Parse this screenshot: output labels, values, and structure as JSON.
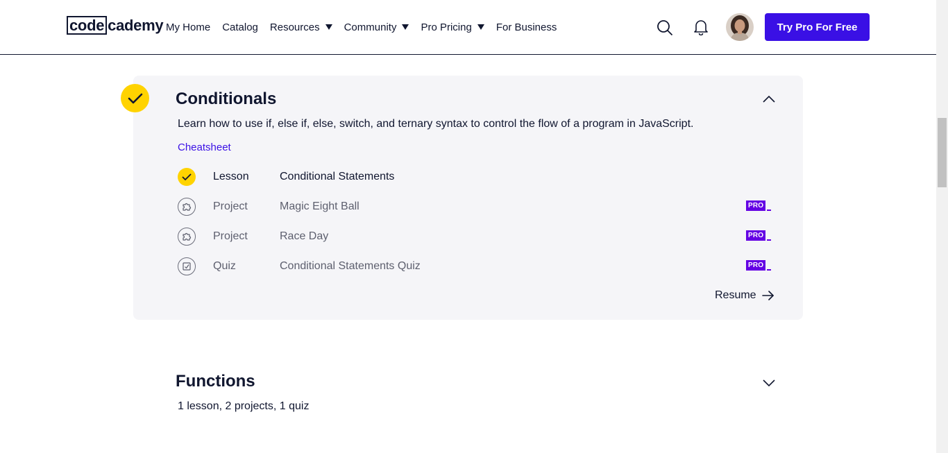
{
  "header": {
    "logo_boxed": "code",
    "logo_rest": "cademy",
    "nav": [
      {
        "label": "My Home",
        "has_caret": false
      },
      {
        "label": "Catalog",
        "has_caret": false
      },
      {
        "label": "Resources",
        "has_caret": true
      },
      {
        "label": "Community",
        "has_caret": true
      },
      {
        "label": "Pro Pricing",
        "has_caret": true
      },
      {
        "label": "For Business",
        "has_caret": false
      }
    ],
    "cta_label": "Try Pro For Free",
    "icons": {
      "search": "search-icon",
      "bell": "bell-icon",
      "caret": "caret-down-icon"
    }
  },
  "modules": [
    {
      "title": "Conditionals",
      "completed": true,
      "expanded": true,
      "description": "Learn how to use if, else if, else, switch, and ternary syntax to control the flow of a program in JavaScript.",
      "cheatsheet_label": "Cheatsheet",
      "items": [
        {
          "type": "Lesson",
          "name": "Conditional Statements",
          "completed": true,
          "pro": false,
          "icon": "check-icon"
        },
        {
          "type": "Project",
          "name": "Magic Eight Ball",
          "completed": false,
          "pro": true,
          "icon": "puzzle-icon"
        },
        {
          "type": "Project",
          "name": "Race Day",
          "completed": false,
          "pro": true,
          "icon": "puzzle-icon"
        },
        {
          "type": "Quiz",
          "name": "Conditional Statements Quiz",
          "completed": false,
          "pro": true,
          "icon": "quiz-icon"
        }
      ],
      "pro_badge_label": "PRO",
      "resume_label": "Resume"
    },
    {
      "title": "Functions",
      "completed": false,
      "expanded": false,
      "summary": "1 lesson, 2 projects, 1 quiz"
    }
  ],
  "colors": {
    "brand_navy": "#10162f",
    "accent_purple": "#3a10e5",
    "pro_purple": "#6400e4",
    "complete_yellow": "#ffd300",
    "card_bg": "#f5f5f8"
  }
}
